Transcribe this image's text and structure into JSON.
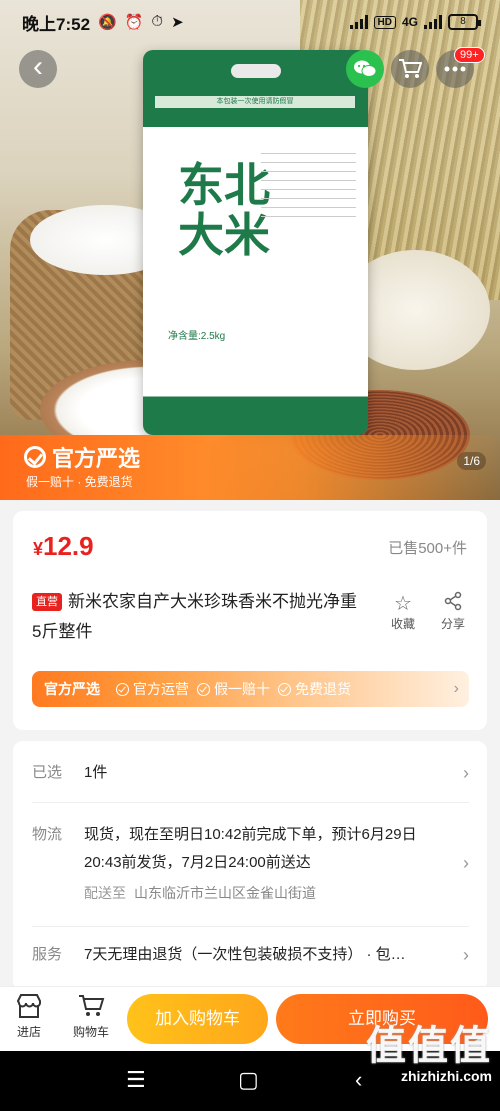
{
  "status_bar": {
    "time": "晚上7:52",
    "network": "4G",
    "hd": "HD",
    "battery": "8"
  },
  "nav": {
    "badge": "99+"
  },
  "hero": {
    "bag_name": "东北大米",
    "bag_weight": "净含量:2.5kg",
    "bag_band": "本包装一次使用请防假冒",
    "banner_brand": "官方严选",
    "banner_sub": "假一赔十 · 免费退货",
    "page_indicator": "1/6"
  },
  "product": {
    "currency": "¥",
    "price": "12.9",
    "sold": "已售500+件",
    "tag": "直营",
    "title": "新米农家自产大米珍珠香米不抛光净重5斤整件",
    "favorite_label": "收藏",
    "share_label": "分享",
    "strip": {
      "brand": "官方严选",
      "items": [
        "官方运营",
        "假一赔十",
        "免费退货"
      ]
    }
  },
  "details": {
    "selected_label": "已选",
    "selected_value": "1件",
    "logistics_label": "物流",
    "logistics_value": "现货，现在至明日10:42前完成下单，预计6月29日20:43前发货，7月2日24:00前送达",
    "ship_to_label": "配送至",
    "ship_to_value": "山东临沂市兰山区金雀山街道",
    "service_label": "服务",
    "service_value": "7天无理由退货（一次性包装破损不支持） · 包…"
  },
  "bottom_bar": {
    "store_label": "进店",
    "cart_label": "购物车",
    "add_to_cart": "加入购物车",
    "buy_now": "立即购买"
  },
  "watermark": {
    "big": "值值值",
    "small": "zhizhizhi.com"
  },
  "colors": {
    "price_red": "#e8231f",
    "orange": "#ff7a1a",
    "yellow": "#ffc21a"
  }
}
